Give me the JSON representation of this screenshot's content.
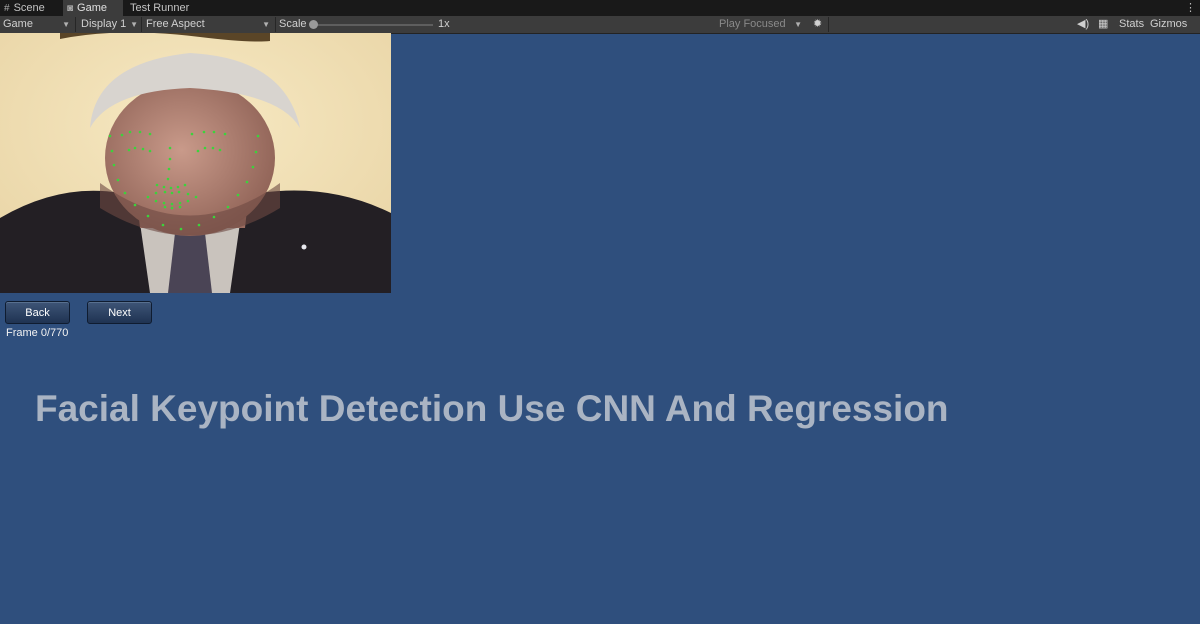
{
  "tabs": [
    {
      "label": "Scene",
      "icon": "grid-icon"
    },
    {
      "label": "Game",
      "icon": "gamepad-icon"
    },
    {
      "label": "Test Runner",
      "icon": ""
    }
  ],
  "toolbar": {
    "view_mode": "Game",
    "display": "Display 1",
    "aspect": "Free Aspect",
    "scale_label": "Scale",
    "scale_value": "1x",
    "play_mode": "Play Focused",
    "stats": "Stats",
    "gizmos": "Gizmos"
  },
  "controls": {
    "back_label": "Back",
    "next_label": "Next",
    "frame_text": "Frame 0/770"
  },
  "headline": "Facial Keypoint Detection Use CNN And Regression",
  "colors": {
    "background": "#2f4f7d",
    "keypoint": "#3bd43b",
    "headline": "#aab4c3"
  }
}
